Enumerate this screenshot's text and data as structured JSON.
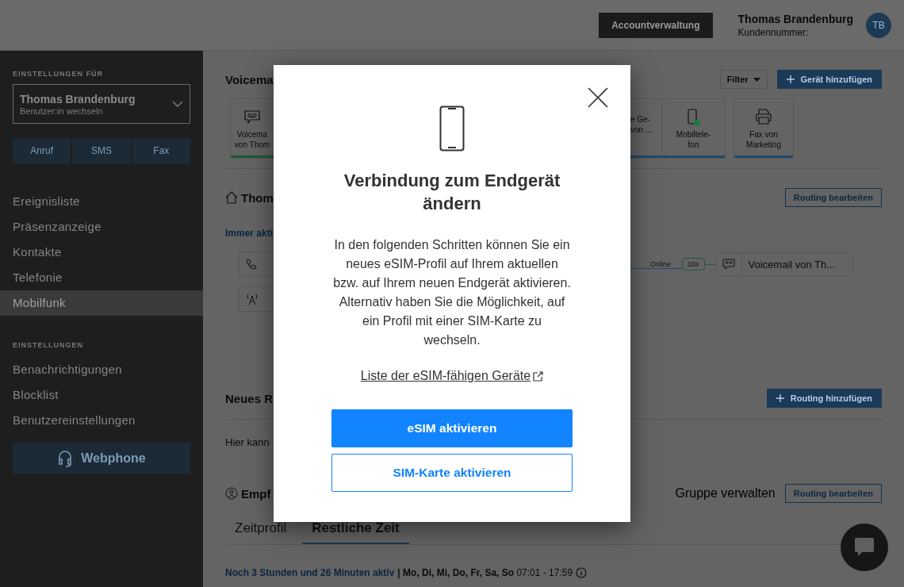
{
  "header": {
    "account_button": "Accountverwaltung",
    "user_name": "Thomas Brandenburg",
    "customer_number_label": "Kundennummer:",
    "avatar_initials": "TB"
  },
  "sidebar": {
    "section_label": "EINSTELLUNGEN FÜR",
    "user_select": {
      "name": "Thomas Brandenburg",
      "hint": "Benutzer:in wechseln"
    },
    "quick_buttons": [
      "Anruf",
      "SMS",
      "Fax"
    ],
    "nav_items": [
      {
        "label": "Ereignisliste",
        "selected": false
      },
      {
        "label": "Präsenzanzeige",
        "selected": false
      },
      {
        "label": "Kontakte",
        "selected": false
      },
      {
        "label": "Telefonie",
        "selected": false
      },
      {
        "label": "Mobilfunk",
        "selected": true
      }
    ],
    "settings_label": "EINSTELLUNGEN",
    "settings_items": [
      {
        "label": "Benachrichtigungen",
        "selected": false
      },
      {
        "label": "Blocklist",
        "selected": false
      },
      {
        "label": "Benutzereinstellungen",
        "selected": false
      }
    ],
    "webphone_button": "Webphone"
  },
  "devices": {
    "title": "Voicema",
    "filter": "Filter",
    "add_button": "Gerät hinzufügen",
    "left_card": {
      "kind": "voicemail",
      "lines": [
        "Voicema",
        "von Thom"
      ],
      "color": "#1e5a3a"
    },
    "right_cards": [
      {
        "kind": "partial",
        "lines": [
          "e Ge-",
          "von ..."
        ],
        "color": "#1f4a70"
      },
      {
        "kind": "mobile",
        "lines": [
          "Mobiltele-",
          "fon"
        ],
        "color": "#1f4a70",
        "online": true
      },
      {
        "kind": "fax",
        "lines": [
          "Fax von",
          "Marketing"
        ],
        "color": "#1f4a70"
      }
    ]
  },
  "routing": {
    "title": "Thom",
    "edit_button": "Routing bearbeiten",
    "status": "Immer akti",
    "online_label": "Online",
    "delay": "10s",
    "target": "Voicemail von Th..."
  },
  "new_routing": {
    "title": "Neues R",
    "add_button": "Routing hinzufügen",
    "text": "Hier kann"
  },
  "group": {
    "title": "Empf",
    "manage_link": "Gruppe verwalten",
    "edit_button": "Routing bearbeiten",
    "tabs": [
      {
        "label": "Zeitprofil",
        "selected": false
      },
      {
        "label": "Restliche Zeit",
        "selected": true
      }
    ],
    "active_note": "Noch 3 Stunden und 26 Minuten aktiv",
    "schedule": "**| Mo, Di, Mi, Do, Fr, Sa, So** 07:01 - 17:59"
  },
  "dialog": {
    "title": "Verbindung zum Endgerät ändern",
    "body": "In den folgenden Schritten können Sie ein neues eSIM-Profil auf Ihrem aktuellen bzw. auf Ihrem neuen Endgerät aktivieren. Alternativ haben Sie die Möglichkeit, auf ein Profil mit einer SIM-Karte zu wechseln.",
    "link": "Liste der eSIM-fähigen Geräte",
    "primary_button": "eSIM aktivieren",
    "secondary_button": "SIM-Karte aktivieren"
  }
}
